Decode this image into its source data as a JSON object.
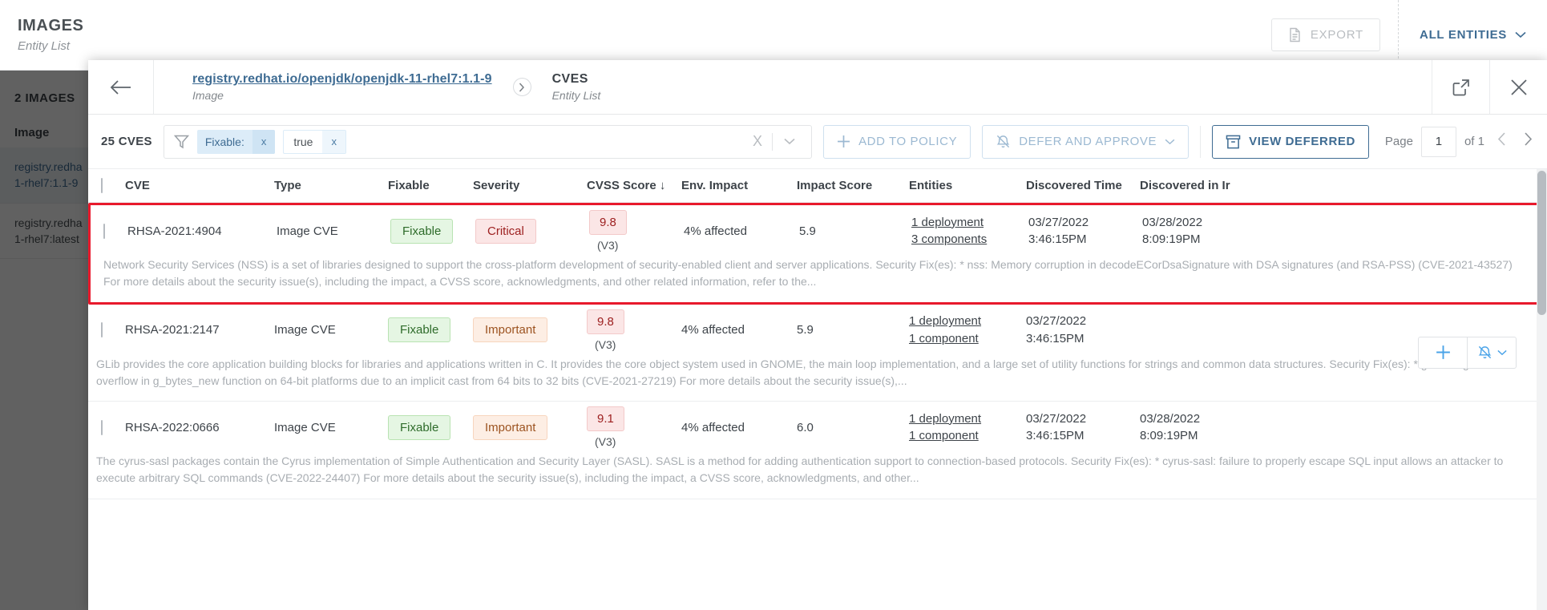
{
  "background": {
    "title": "IMAGES",
    "subtitle": "Entity List",
    "export_label": "EXPORT",
    "all_entities_label": "ALL ENTITIES",
    "count_label": "2 IMAGES",
    "column_header": "Image",
    "items": [
      {
        "line1": "registry.redha",
        "line2": "1-rhel7:1.1-9",
        "selected": true
      },
      {
        "line1": "registry.redha",
        "line2": "1-rhel7:latest",
        "selected": false
      }
    ]
  },
  "panel": {
    "breadcrumb": {
      "parent_link": "registry.redhat.io/openjdk/openjdk-11-rhel7:1.1-9",
      "parent_type": "Image",
      "current_title": "CVES",
      "current_type": "Entity List"
    },
    "toolbar": {
      "count": "25 CVES",
      "filters": [
        {
          "text": "Fixable:",
          "close": "x",
          "kind": "key"
        },
        {
          "text": "true",
          "close": "x",
          "kind": "value"
        }
      ],
      "clear_all": "X",
      "add_to_policy": "ADD TO POLICY",
      "defer_and_approve": "DEFER AND APPROVE",
      "view_deferred": "VIEW DEFERRED",
      "page_label": "Page",
      "page_value": "1",
      "page_of": "of 1"
    },
    "table": {
      "columns": [
        "CVE",
        "Type",
        "Fixable",
        "Severity",
        "CVSS Score ↓",
        "Env. Impact",
        "Impact Score",
        "Entities",
        "Discovered Time",
        "Discovered in Ir"
      ],
      "rows": [
        {
          "cve": "RHSA-2021:4904",
          "type": "Image CVE",
          "fixable": "Fixable",
          "severity": "Critical",
          "severity_kind": "critical",
          "cvss": "9.8",
          "cvss_version": "(V3)",
          "env_impact": "4% affected",
          "impact_score": "5.9",
          "entities": [
            "1 deployment",
            "3 components"
          ],
          "discovered_date": "03/27/2022",
          "discovered_time": "3:46:15PM",
          "discovered_in_image_date": "03/28/2022",
          "discovered_in_image_time": "8:09:19PM",
          "description": "Network Security Services (NSS) is a set of libraries designed to support the cross-platform development of security-enabled client and server applications. Security Fix(es): * nss: Memory corruption in decodeECorDsaSignature with DSA signatures (and RSA-PSS) (CVE-2021-43527) For more details about the security issue(s), including the impact, a CVSS score, acknowledgments, and other related information, refer to the...",
          "highlighted": true,
          "show_actions": false
        },
        {
          "cve": "RHSA-2021:2147",
          "type": "Image CVE",
          "fixable": "Fixable",
          "severity": "Important",
          "severity_kind": "important",
          "cvss": "9.8",
          "cvss_version": "(V3)",
          "env_impact": "4% affected",
          "impact_score": "5.9",
          "entities": [
            "1 deployment",
            "1 component"
          ],
          "discovered_date": "03/27/2022",
          "discovered_time": "3:46:15PM",
          "discovered_in_image_date": "",
          "discovered_in_image_time": "",
          "description": "GLib provides the core application building blocks for libraries and applications written in C. It provides the core object system used in GNOME, the main loop implementation, and a large set of utility functions for strings and common data structures. Security Fix(es): * glib: integer overflow in g_bytes_new function on 64-bit platforms due to an implicit cast from 64 bits to 32 bits (CVE-2021-27219) For more details about the security issue(s),...",
          "highlighted": false,
          "show_actions": true
        },
        {
          "cve": "RHSA-2022:0666",
          "type": "Image CVE",
          "fixable": "Fixable",
          "severity": "Important",
          "severity_kind": "important",
          "cvss": "9.1",
          "cvss_version": "(V3)",
          "env_impact": "4% affected",
          "impact_score": "6.0",
          "entities": [
            "1 deployment",
            "1 component"
          ],
          "discovered_date": "03/27/2022",
          "discovered_time": "3:46:15PM",
          "discovered_in_image_date": "03/28/2022",
          "discovered_in_image_time": "8:09:19PM",
          "description": "The cyrus-sasl packages contain the Cyrus implementation of Simple Authentication and Security Layer (SASL). SASL is a method for adding authentication support to connection-based protocols. Security Fix(es): * cyrus-sasl: failure to properly escape SQL input allows an attacker to execute arbitrary SQL commands (CVE-2022-24407) For more details about the security issue(s), including the impact, a CVSS score, acknowledgments, and other...",
          "highlighted": false,
          "show_actions": false
        }
      ]
    }
  },
  "colors": {
    "accent_blue": "#3f6c93",
    "highlight_red": "#e8192c",
    "critical": "#9d2020",
    "important": "#9c5320",
    "fixable_green": "#2e6b2a"
  }
}
